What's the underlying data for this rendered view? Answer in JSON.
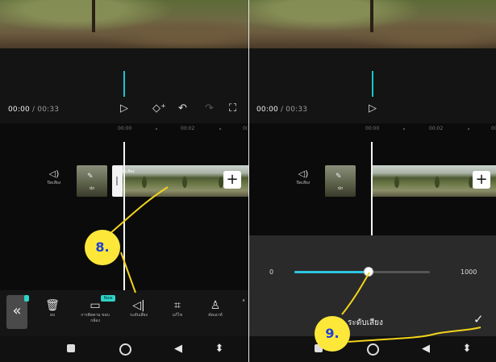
{
  "left_panel": {
    "time": {
      "current": "00:00",
      "total": "/ 00:33"
    },
    "ruler": [
      "00:00",
      "00:02",
      "0("
    ],
    "speaker_label": "ปิดเสียง",
    "cover_label": "ปก",
    "clip_title": "ปิดเสียง",
    "expand_label": "«",
    "tools": [
      {
        "icon": "trash-icon",
        "glyph": "🗑",
        "label": "ลบ"
      },
      {
        "icon": "camera-icon",
        "glyph": "▭",
        "label": "การติดตาม ขอบกล้อง"
      },
      {
        "icon": "volume-icon",
        "glyph": "◁|",
        "label": "ระดับเสียง"
      },
      {
        "icon": "crop-icon",
        "glyph": "⌗",
        "label": "แก้ไข"
      },
      {
        "icon": "person-remove-icon",
        "glyph": "♙",
        "label": "คัดเอาท์"
      },
      {
        "icon": "more-icon",
        "glyph": "",
        "label": "ส"
      }
    ],
    "new_badge": "New",
    "callout": "8."
  },
  "right_panel": {
    "time": {
      "current": "00:00",
      "total": "/ 00:33"
    },
    "ruler": [
      "00:00",
      "00:02",
      "00"
    ],
    "speaker_label": "ปิดเสียง",
    "cover_label": "ปก",
    "volume": {
      "min_label": "0",
      "max_label": "1000",
      "value_fraction": 0.55
    },
    "sheet_title": "ระดับเสียง",
    "callout": "9."
  },
  "colors": {
    "accent": "#19c6c9",
    "callout_bg": "#fde83a",
    "callout_text": "#1f3fd1",
    "annotation_line": "#f2d31b"
  }
}
